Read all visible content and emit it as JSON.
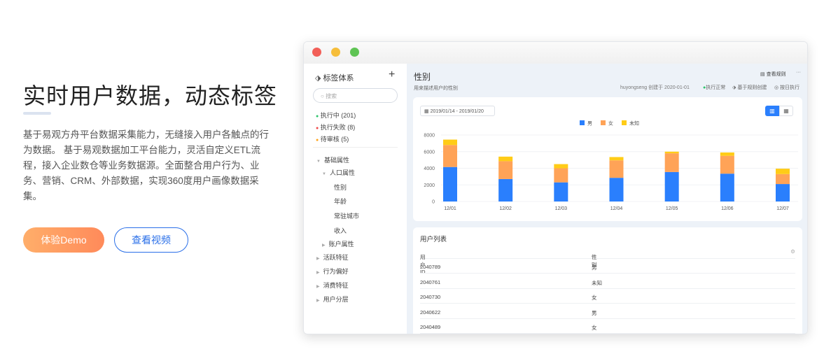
{
  "hero": {
    "title": "实时用户数据，动态标签",
    "description": "基于易观方舟平台数据采集能力，无缝接入用户各触点的行为数据。 基于易观数据加工平台能力，灵活自定义ETL流程，接入企业数仓等业务数据源。全面整合用户行为、业务、营销、CRM、外部数据，实现360度用户画像数据采集。",
    "demo_button": "体验Demo",
    "video_button": "查看视频"
  },
  "sidebar": {
    "title": "标签体系",
    "add": "+",
    "search_placeholder": "搜索",
    "status": [
      {
        "label": "执行中 (201)",
        "color": "#2bc46a"
      },
      {
        "label": "执行失败 (8)",
        "color": "#f04848"
      },
      {
        "label": "待审核 (5)",
        "color": "#ffa41a"
      }
    ],
    "tree": [
      {
        "label": "基础属性",
        "level": 0,
        "arrow": "▼"
      },
      {
        "label": "人口属性",
        "level": 1,
        "arrow": "▼"
      },
      {
        "label": "性别",
        "level": 2
      },
      {
        "label": "年龄",
        "level": 2
      },
      {
        "label": "常驻城市",
        "level": 2
      },
      {
        "label": "收入",
        "level": 2
      },
      {
        "label": "账户属性",
        "level": 1,
        "arrow": "▶"
      },
      {
        "label": "活跃特征",
        "level": 0,
        "arrow": "▶"
      },
      {
        "label": "行为偏好",
        "level": 0,
        "arrow": "▶"
      },
      {
        "label": "消费特征",
        "level": 0,
        "arrow": "▶"
      },
      {
        "label": "用户分层",
        "level": 0,
        "arrow": "▶"
      }
    ]
  },
  "detail": {
    "title": "性别",
    "subtitle": "用来描述用户的性别",
    "view_rules": "查看规则",
    "more": "···",
    "creator": "huyongseng 创建于 2020-01-01",
    "status": "执行正常",
    "rule_type": "基于规则创建",
    "schedule": "按日执行",
    "date_range": "2019/01/14 - 2019/01/20"
  },
  "chart_data": {
    "type": "bar",
    "stacked": true,
    "categories": [
      "12/01",
      "12/02",
      "12/03",
      "12/04",
      "12/05",
      "12/06",
      "12/07"
    ],
    "series": [
      {
        "name": "男",
        "color": "#2a7ffd",
        "values": [
          4150,
          2700,
          2300,
          2850,
          3550,
          3350,
          2100
        ]
      },
      {
        "name": "女",
        "color": "#ffa357",
        "values": [
          2650,
          2150,
          1700,
          2100,
          2250,
          2150,
          1200
        ]
      },
      {
        "name": "未知",
        "color": "#ffcc17",
        "values": [
          650,
          550,
          500,
          400,
          200,
          400,
          650
        ]
      }
    ],
    "ylim": [
      0,
      8000
    ],
    "yticks": [
      "0",
      "2000",
      "4000",
      "6000",
      "8000"
    ],
    "legend": "top-center",
    "grid": true
  },
  "table": {
    "title": "用户列表",
    "columns": [
      "用户ID",
      "性别"
    ],
    "rows": [
      [
        "2040789",
        "男"
      ],
      [
        "2040761",
        "未知"
      ],
      [
        "2040730",
        "女"
      ],
      [
        "2040622",
        "男"
      ],
      [
        "2040489",
        "女"
      ]
    ]
  }
}
